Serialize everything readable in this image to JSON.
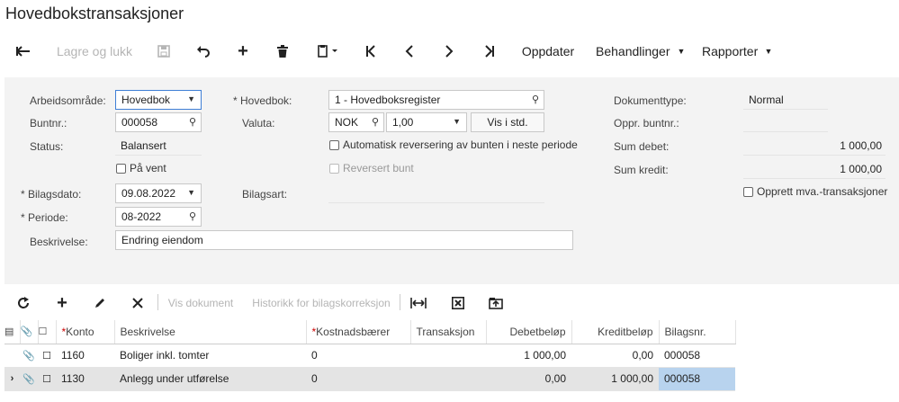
{
  "page": {
    "title": "Hovedbokstransaksjoner"
  },
  "toolbar": {
    "save_close": "Lagre og lukk",
    "refresh": "Oppdater",
    "actions": "Behandlinger",
    "reports": "Rapporter"
  },
  "form": {
    "workspace_label": "Arbeidsområde:",
    "workspace_value": "Hovedbok",
    "batch_label": "Buntnr.:",
    "batch_value": "000058",
    "status_label": "Status:",
    "status_value": "Balansert",
    "onhold_label": "På vent",
    "ledger_label": "Hovedbok:",
    "ledger_value": "1 - Hovedboksregister",
    "currency_label": "Valuta:",
    "currency_value": "NOK",
    "rate_value": "1,00",
    "vis_std": "Vis i std.",
    "auto_reverse_label": "Automatisk reversering av bunten i neste periode",
    "reversed_label": "Reversert bunt",
    "doctype_label": "Dokumenttype:",
    "doctype_value": "Normal",
    "orig_batch_label": "Oppr. buntnr.:",
    "sum_debit_label": "Sum debet:",
    "sum_debit_value": "1 000,00",
    "sum_credit_label": "Sum kredit:",
    "sum_credit_value": "1 000,00",
    "create_vat_label": "Opprett mva.-transaksjoner",
    "date_label": "Bilagsdato:",
    "date_value": "09.08.2022",
    "period_label": "Periode:",
    "period_value": "08-2022",
    "voucher_type_label": "Bilagsart:",
    "description_label": "Beskrivelse:",
    "description_value": "Endring eiendom"
  },
  "grid_toolbar": {
    "view_doc": "Vis dokument",
    "history": "Historikk for bilagskorreksjon"
  },
  "grid": {
    "columns": [
      "Konto",
      "Beskrivelse",
      "Kostnadsbærer",
      "Transaksjon",
      "Debetbeløp",
      "Kreditbeløp",
      "Bilagsnr."
    ],
    "rows": [
      {
        "account": "1160",
        "desc": "Boliger inkl. tomter",
        "cost": "0",
        "trans": "",
        "debit": "1 000,00",
        "credit": "0,00",
        "voucher": "000058"
      },
      {
        "account": "1130",
        "desc": "Anlegg under utførelse",
        "cost": "0",
        "trans": "",
        "debit": "0,00",
        "credit": "1 000,00",
        "voucher": "000058"
      }
    ]
  },
  "colors": {
    "accent": "#3f7fd6",
    "selected_cell": "#b8d3ee",
    "form_bg": "#f3f3f3"
  }
}
